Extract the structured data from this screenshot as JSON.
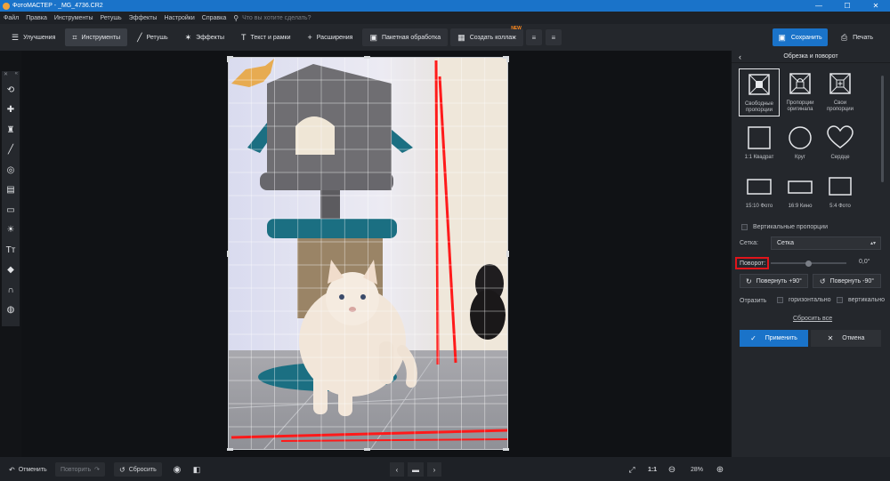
{
  "titlebar": {
    "title": "ФотоМАСТЕР - _MG_4736.CR2",
    "minimize": "—",
    "maximize": "☐",
    "close": "✕"
  },
  "menu": {
    "items": [
      "Файл",
      "Правка",
      "Инструменты",
      "Ретушь",
      "Эффекты",
      "Настройки",
      "Справка"
    ],
    "search_placeholder": "Что вы хотите сделать?"
  },
  "toolbar": {
    "improve": "Улучшения",
    "tools": "Инструменты",
    "retouch": "Ретушь",
    "effects": "Эффекты",
    "text_frames": "Текст и рамки",
    "extensions": "Расширения",
    "batch": "Пакетная обработка",
    "collage": "Создать коллаж",
    "collage_badge": "NEW",
    "save": "Сохранить",
    "print": "Печать"
  },
  "panel": {
    "title": "Обрезка и поворот",
    "presets": [
      {
        "label": "Свободные\nпропорции",
        "icon": "free-proportions-icon",
        "selected": true
      },
      {
        "label": "Пропорции\nоригинала",
        "icon": "lock-proportions-icon",
        "selected": false
      },
      {
        "label": "Свои\nпропорции",
        "icon": "custom-proportions-icon",
        "selected": false
      },
      {
        "label": "1:1 Квадрат",
        "icon": "square-icon",
        "selected": false
      },
      {
        "label": "Круг",
        "icon": "circle-icon",
        "selected": false
      },
      {
        "label": "Сердце",
        "icon": "heart-icon",
        "selected": false
      },
      {
        "label": "15:10 Фото",
        "icon": "rect-15-10-icon",
        "selected": false
      },
      {
        "label": "16:9 Кино",
        "icon": "rect-16-9-icon",
        "selected": false
      },
      {
        "label": "5:4 Фото",
        "icon": "rect-5-4-icon",
        "selected": false
      }
    ],
    "vertical_proportions": "Вертикальные пропорции",
    "grid_label": "Сетка:",
    "grid_value": "Сетка",
    "rotation_label": "Поворот:",
    "rotation_value": "0,0°",
    "rotation_fraction": 0.5,
    "rotate_plus": "Повернуть +90°",
    "rotate_minus": "Повернуть -90°",
    "flip_label": "Отразить",
    "flip_horizontal": "горизонтально",
    "flip_vertical": "вертикально",
    "reset_all": "Сбросить все",
    "apply": "Применить",
    "cancel": "Отмена"
  },
  "bottombar": {
    "undo": "Отменить",
    "redo": "Повторить",
    "reset": "Сбросить",
    "ratio": "1:1",
    "zoom": "28%"
  },
  "colors": {
    "accent": "#1a73c9",
    "highlight": "#e0151b",
    "guide_lines": "#ff1a1a"
  }
}
